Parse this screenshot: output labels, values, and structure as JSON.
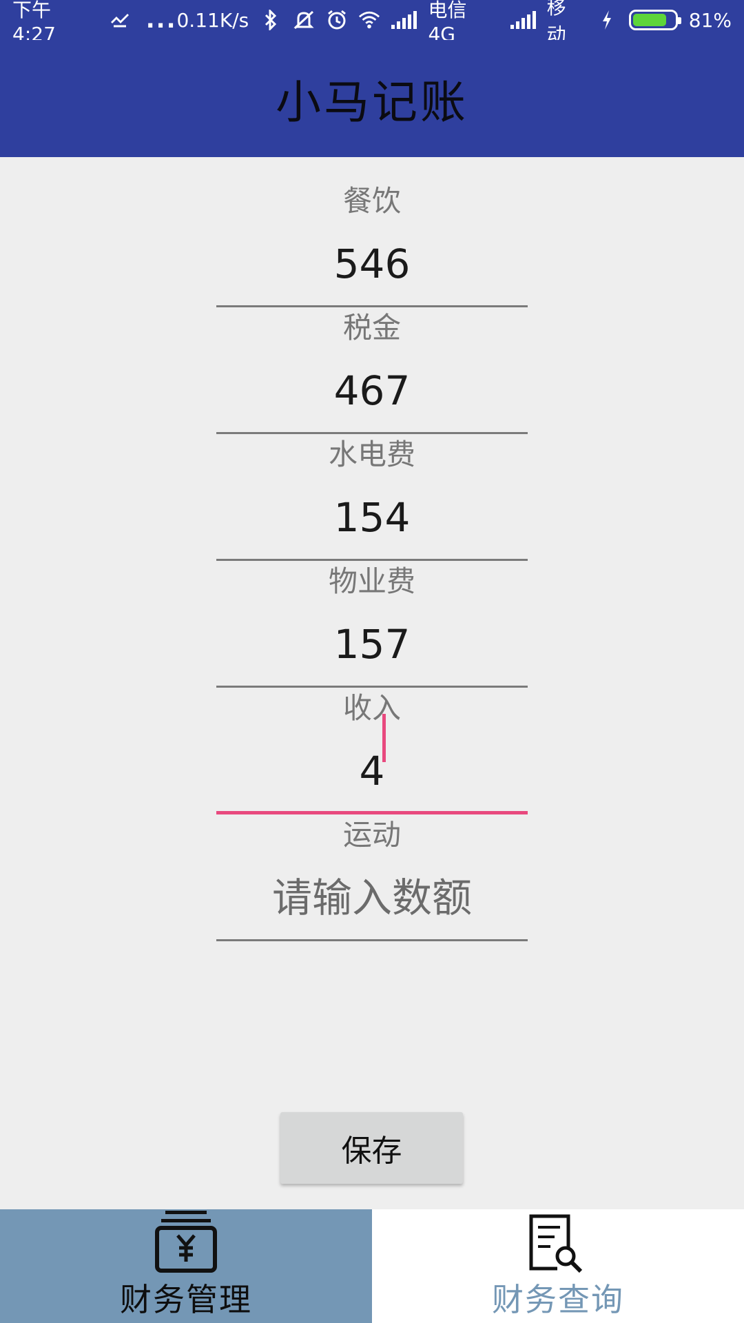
{
  "status_bar": {
    "time": "下午4:27",
    "dots": "...",
    "speed": "0.11K/s",
    "carrier1": "电信 4G",
    "carrier2": "移动",
    "battery": "81%",
    "battery_level": 0.81,
    "battery_color": "#5ed53a"
  },
  "app_bar": {
    "title": "小马记账",
    "color": "#2f3f9e"
  },
  "form": {
    "fields": [
      {
        "label": "餐饮",
        "value": "546"
      },
      {
        "label": "税金",
        "value": "467"
      },
      {
        "label": "水电费",
        "value": "154"
      },
      {
        "label": "物业费",
        "value": "157"
      },
      {
        "label": "收入",
        "value": "4"
      },
      {
        "label": "运动",
        "value": "",
        "placeholder": "请输入数额"
      }
    ],
    "save_label": "保存",
    "accent": "#e8497e"
  },
  "bottom_nav": {
    "tabs": [
      {
        "label": "财务管理",
        "icon": "yuan-wallet-icon",
        "selected": true
      },
      {
        "label": "财务查询",
        "icon": "document-search-icon",
        "selected": false
      }
    ],
    "selected_color": "#7497b5"
  }
}
